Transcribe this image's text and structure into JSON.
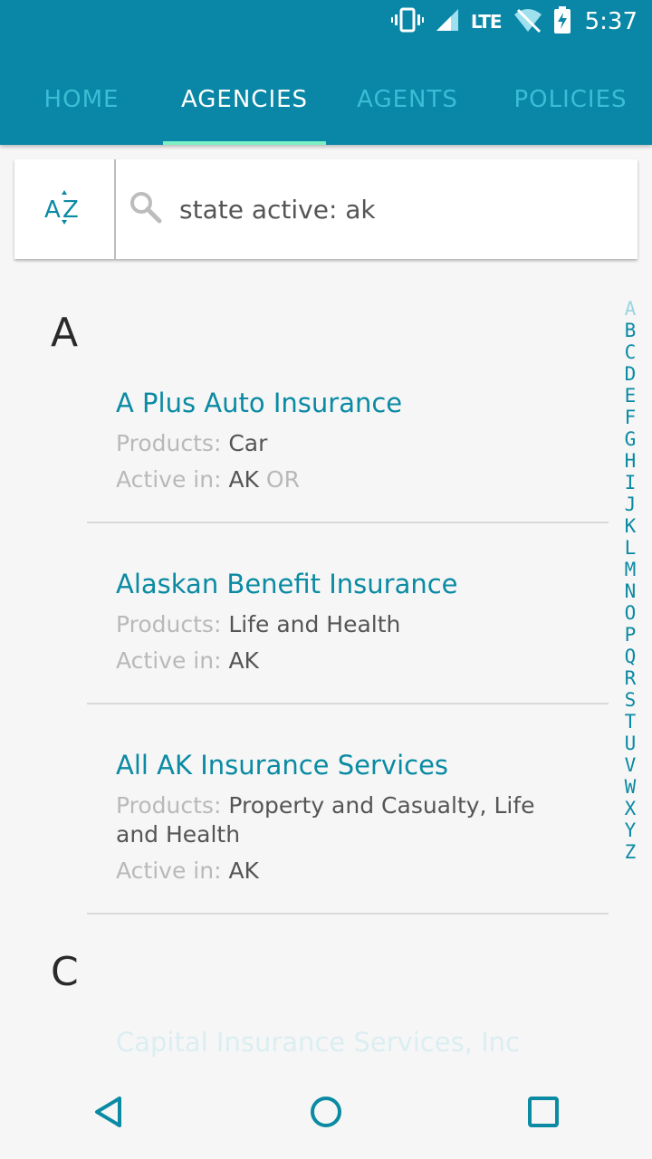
{
  "status_bar": {
    "network": "LTE",
    "time": "5:37"
  },
  "tabs": [
    {
      "label": "HOME",
      "active": false
    },
    {
      "label": "AGENCIES",
      "active": true
    },
    {
      "label": "AGENTS",
      "active": false
    },
    {
      "label": "POLICIES",
      "active": false
    }
  ],
  "search": {
    "value": "state active: ak",
    "sort_icon": "sort-az-icon",
    "search_icon": "search-icon"
  },
  "labels": {
    "products": "Products:",
    "active_in": "Active in:"
  },
  "sections": [
    {
      "letter": "A",
      "items": [
        {
          "name": "A Plus Auto Insurance",
          "products": "Car",
          "active_in": "AK",
          "active_in_extra": "OR"
        },
        {
          "name": "Alaskan Benefit Insurance",
          "products": "Life and Health",
          "active_in": "AK"
        },
        {
          "name": "All AK Insurance Services",
          "products": "Property and Casualty, Life and Health",
          "active_in": "AK"
        }
      ]
    },
    {
      "letter": "C",
      "items": [
        {
          "name": "Capital Insurance Services, Inc"
        }
      ]
    }
  ],
  "alphabet_index": [
    "A",
    "B",
    "C",
    "D",
    "E",
    "F",
    "G",
    "H",
    "I",
    "J",
    "K",
    "L",
    "M",
    "N",
    "O",
    "P",
    "Q",
    "R",
    "S",
    "T",
    "U",
    "V",
    "W",
    "X",
    "Y",
    "Z"
  ],
  "colors": {
    "appbar": "#0a87a6",
    "accent": "#0a8aa3",
    "indicator": "#7cf0c4",
    "inactive_tab": "#3bbdd6"
  }
}
